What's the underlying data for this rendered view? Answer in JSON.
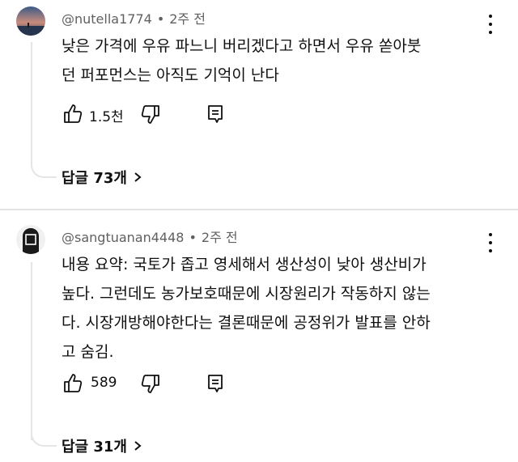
{
  "comments": [
    {
      "author": "@nutella1774",
      "time": "2주 전",
      "lines": [
        "낮은 가격에 우유 파느니 버리겠다고 하면서 우유 쏟아붓",
        "던 퍼포먼스는 아직도 기억이 난다"
      ],
      "likes": "1.5천",
      "replies": "답글 73개"
    },
    {
      "author": "@sangtuanan4448",
      "time": "2주 전",
      "lines": [
        "내용 요약: 국토가 좁고 영세해서 생산성이 낮아 생산비가",
        "높다. 그런데도 농가보호때문에 시장원리가 작동하지 않는",
        "다. 시장개방해야한다는 결론때문에 공정위가 발표를 안하",
        "고 숨김."
      ],
      "likes": "589",
      "replies": "답글 31개"
    }
  ],
  "icons": [
    "like-icon",
    "dislike-icon",
    "reply-icon",
    "more-icon",
    "chevron-right-icon"
  ],
  "colors": {
    "text": "#0f0f0f",
    "meta": "#606060",
    "line": "#e5e5e5"
  }
}
